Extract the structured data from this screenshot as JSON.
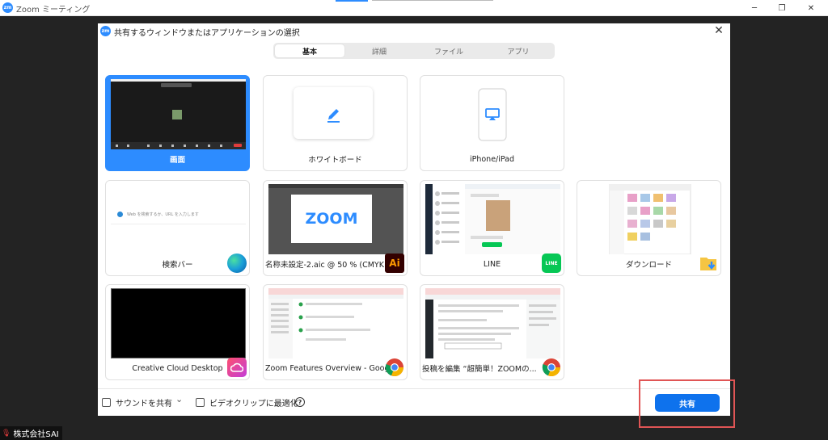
{
  "window": {
    "title": "Zoom ミーティング",
    "logo_text": "zm",
    "min_icon": "─",
    "restore_icon": "❐",
    "close_icon": "✕"
  },
  "dialog": {
    "logo_text": "zm",
    "title": "共有するウィンドウまたはアプリケーションの選択",
    "close_icon": "✕",
    "tabs": [
      {
        "label": "基本",
        "active": true
      },
      {
        "label": "詳細",
        "active": false
      },
      {
        "label": "ファイル",
        "active": false
      },
      {
        "label": "アプリ",
        "active": false
      }
    ],
    "tiles": [
      {
        "label": "画面",
        "selected": true
      },
      {
        "label": "ホワイトボード"
      },
      {
        "label": "iPhone/iPad"
      },
      {
        "label": "検索バー",
        "search_placeholder": "Web を検索するか、URL を入力します"
      },
      {
        "label": "名称未設定-2.aic @ 50 % (CMYK...",
        "thumb_text": "ZOOM",
        "icon_text": "Ai"
      },
      {
        "label": "LINE",
        "icon_text": "LINE"
      },
      {
        "label": "ダウンロード"
      },
      {
        "label": "Creative Cloud Desktop"
      },
      {
        "label": "Zoom Features Overview - Googl..."
      },
      {
        "label": "投稿を編集 “超簡単！ZOOMの..."
      }
    ],
    "footer": {
      "sound_label": "サウンドを共有",
      "sound_chevron": "⌄",
      "video_label": "ビデオクリップに最適化",
      "help_icon": "?",
      "share_label": "共有"
    }
  },
  "participant": {
    "name": "株式会社SAI",
    "mic_icon": "🎙"
  },
  "colors": {
    "accent": "#2d8cff",
    "share_button": "#0e72ed",
    "highlight_box": "#e05555"
  }
}
